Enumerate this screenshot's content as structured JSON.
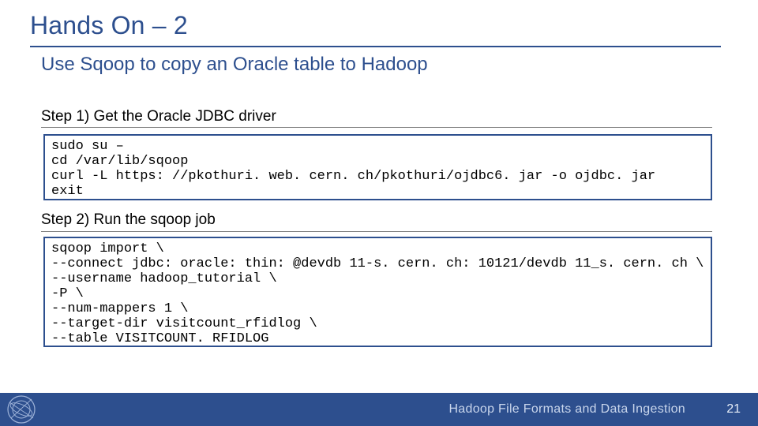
{
  "title": "Hands On – 2",
  "subtitle": "Use Sqoop to copy an Oracle table to Hadoop",
  "step1": "Step 1) Get the Oracle JDBC driver",
  "code1": "sudo su –\ncd /var/lib/sqoop\ncurl -L https: //pkothuri. web. cern. ch/pkothuri/ojdbc6. jar -o ojdbc. jar\nexit",
  "step2": "Step 2) Run the sqoop job",
  "code2": "sqoop import \\\n--connect jdbc: oracle: thin: @devdb 11-s. cern. ch: 10121/devdb 11_s. cern. ch \\\n--username hadoop_tutorial \\\n-P \\\n--num-mappers 1 \\\n--target-dir visitcount_rfidlog \\\n--table VISITCOUNT. RFIDLOG",
  "footer_text": "Hadoop File Formats and Data Ingestion",
  "page_number": "21"
}
